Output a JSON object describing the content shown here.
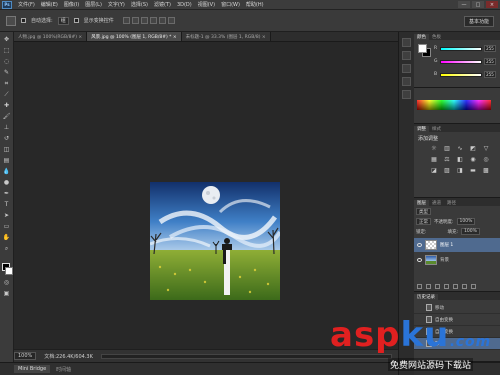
{
  "menu": {
    "logo": "Ps",
    "items": [
      "文件(F)",
      "编辑(E)",
      "图像(I)",
      "图层(L)",
      "文字(Y)",
      "选择(S)",
      "滤镜(T)",
      "3D(D)",
      "视图(V)",
      "窗口(W)",
      "帮助(H)"
    ],
    "window_controls": [
      "—",
      "□",
      "×"
    ]
  },
  "options": {
    "auto_select_label": "自动选择:",
    "auto_select_value": "组",
    "transform_label": "显示变换控件",
    "workspace": "基本功能"
  },
  "tabs": [
    {
      "label": "人物.jpg @ 100%(RGB/8#) ×",
      "active": false
    },
    {
      "label": "风景.jpg @ 100% (图层 1, RGB/8#) * ×",
      "active": true
    },
    {
      "label": "未标题-1 @ 33.3% (图层 1, RGB/8) ×",
      "active": false
    }
  ],
  "status": {
    "zoom": "100%",
    "doc_info": "文档:226.4K/604.3K"
  },
  "mini_bridge": [
    "Mini Bridge",
    "时间轴"
  ],
  "color_panel": {
    "tabs": [
      "颜色",
      "色板"
    ],
    "channels": [
      {
        "label": "R",
        "value": "255"
      },
      {
        "label": "G",
        "value": "255"
      },
      {
        "label": "B",
        "value": "255"
      }
    ]
  },
  "adjust_panel": {
    "tabs": [
      "调整",
      "样式"
    ],
    "title": "添加调整"
  },
  "layers_panel": {
    "tabs": [
      "图层",
      "通道",
      "路径"
    ],
    "filter": "类型",
    "blend_mode": "正常",
    "opacity_label": "不透明度:",
    "opacity": "100%",
    "lock_label": "锁定:",
    "fill_label": "填充:",
    "fill": "100%",
    "layers": [
      {
        "name": "图层 1",
        "selected": true
      },
      {
        "name": "背景",
        "selected": false
      }
    ]
  },
  "history_panel": {
    "tabs": [
      "历史记录"
    ],
    "items": [
      {
        "label": "移动",
        "active": false
      },
      {
        "label": "自由变换",
        "active": false
      },
      {
        "label": "自由变换",
        "active": false
      },
      {
        "label": "移动",
        "active": true
      }
    ]
  },
  "watermark": {
    "part1": "asp",
    "part2": "ku",
    "dot": ".",
    "suffix": "com",
    "subtitle": "免费网站源码下载站"
  },
  "colors": {
    "accent_selected": "#4f6a8f",
    "watermark_red": "#e02020",
    "watermark_blue": "#2a74d8"
  }
}
